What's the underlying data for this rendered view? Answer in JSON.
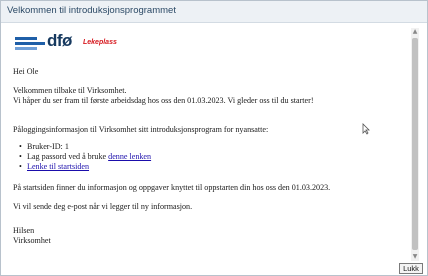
{
  "dialog": {
    "title": "Velkommen til introduksjonsprogrammet",
    "close_label": "Lukk"
  },
  "logo": {
    "word": "dfø",
    "tagline": "Lekeplass",
    "colors": {
      "primary": "#16395f",
      "bars": "#1f5fa8",
      "tag": "#d6181e"
    }
  },
  "message": {
    "greeting": "Hei Ole",
    "welcome_line1": "Velkommen tilbake til Virksomhet.",
    "welcome_line2": "Vi håper du ser fram til første arbeidsdag hos oss den 01.03.2023. Vi gleder oss til du starter!",
    "login_intro": "Påloggingsinformasjon til Virksomhet sitt introduksjonsprogram for nyansatte:",
    "bullets": {
      "user_id": "Bruker-ID: 1",
      "password_prefix": "Lag passord ved å bruke ",
      "password_link": "denne lenken",
      "start_link": "Lenke til startsiden"
    },
    "startpage_info": "På startsiden finner du informasjon og oppgaver knyttet til oppstarten din hos oss den 01.03.2023.",
    "more_info": "Vi vil sende deg e-post når vi legger til ny informasjon.",
    "signoff": "Hilsen",
    "sender": "Virksomhet"
  },
  "icons": {
    "scroll_up": "arrow-up-icon",
    "scroll_down": "arrow-down-icon",
    "cursor": "text-cursor-icon"
  }
}
